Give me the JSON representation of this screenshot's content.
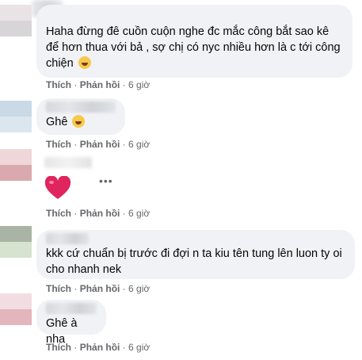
{
  "colors": {
    "bubble_bg": "#f0f2f5",
    "meta_text": "#65676b",
    "heart": "#e0245e"
  },
  "comments": [
    {
      "text": "Haha đừng đê cuồn cuộn nghe đc mắc công bắt sao kê để hơn thua với bả , sợ chị có nyc nhiều hơn là c tới công chiện",
      "emoji": "rolling-laughing-emoji",
      "action_like": "Thích",
      "action_reply": "Phản hồi",
      "time": "6 giờ"
    },
    {
      "text": "Ghê",
      "emoji": "laughing-tears-emoji",
      "action_like": "Thích",
      "action_reply": "Phản hồi",
      "time": "6 giờ"
    },
    {
      "sticker": "red-heart-icon",
      "more": "•••",
      "action_like": "Thích",
      "action_reply": "Phản hồi",
      "time": "6 giờ"
    },
    {
      "text": "kkk cứ chuẩn bị trước đi đợi n ta kiu tên tung lên luon ty oi cho nhanh nek",
      "action_like": "Thích",
      "action_reply": "Phản hồi",
      "time": "6 giờ"
    },
    {
      "text": "Ghê à nha",
      "action_like": "Thích",
      "action_reply": "Phản hồi",
      "time": "6 giờ"
    }
  ],
  "separator": "·"
}
